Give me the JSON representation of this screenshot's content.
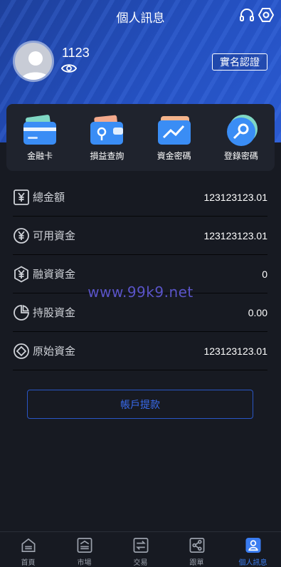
{
  "header": {
    "title": "個人訊息"
  },
  "profile": {
    "username": "1123",
    "auth_label": "實名認證"
  },
  "quick_actions": [
    {
      "label": "金融卡",
      "icon": "bank-card-icon"
    },
    {
      "label": "損益查詢",
      "icon": "wallet-pin-icon"
    },
    {
      "label": "資金密碼",
      "icon": "fund-chart-icon"
    },
    {
      "label": "登錄密碼",
      "icon": "login-key-icon"
    }
  ],
  "balances": [
    {
      "label": "總金額",
      "value": "123123123.01",
      "icon": "yen-square-icon"
    },
    {
      "label": "可用資金",
      "value": "123123123.01",
      "icon": "yen-circle-icon"
    },
    {
      "label": "融資資金",
      "value": "0",
      "icon": "yen-hexagon-icon"
    },
    {
      "label": "持股資金",
      "value": "0.00",
      "icon": "pie-icon"
    },
    {
      "label": "原始資金",
      "value": "123123123.01",
      "icon": "diamond-circle-icon"
    }
  ],
  "watermark": "www.99k9.net",
  "withdraw_label": "帳戶提款",
  "tabs": [
    {
      "label": "首頁",
      "icon": "home-icon"
    },
    {
      "label": "市場",
      "icon": "market-icon"
    },
    {
      "label": "交易",
      "icon": "exchange-icon"
    },
    {
      "label": "跟單",
      "icon": "share-icon"
    },
    {
      "label": "個人訊息",
      "icon": "user-icon",
      "active": true
    }
  ],
  "colors": {
    "accent": "#3a7cf0",
    "hero": "#2450c0",
    "background": "#171a22",
    "card": "#1f232d"
  }
}
